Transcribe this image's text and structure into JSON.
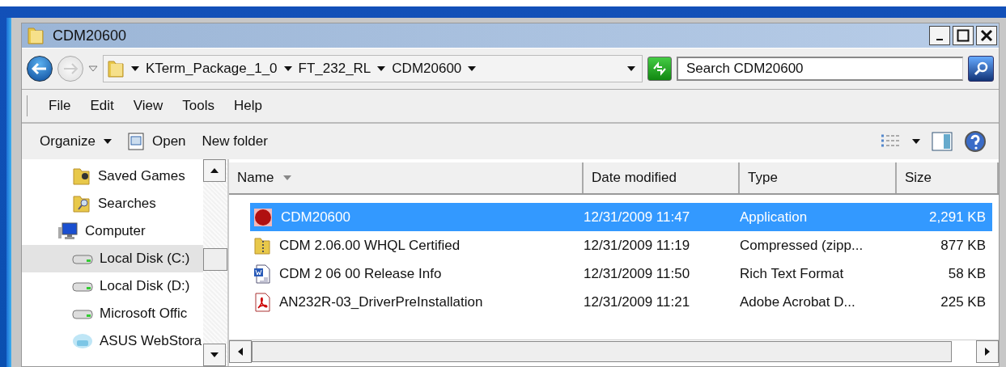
{
  "window": {
    "title": "CDM20600"
  },
  "address_bar": {
    "crumbs": [
      "KTerm_Package_1_0",
      "FT_232_RL",
      "CDM20600"
    ]
  },
  "search": {
    "placeholder": "Search CDM20600"
  },
  "menu": [
    "File",
    "Edit",
    "View",
    "Tools",
    "Help"
  ],
  "toolbar": {
    "organize": "Organize",
    "open": "Open",
    "new_folder": "New folder"
  },
  "sidebar": {
    "items": [
      {
        "label": "Saved Games",
        "kind": "folder",
        "selected": false
      },
      {
        "label": "Searches",
        "kind": "search-folder",
        "selected": false
      },
      {
        "label": "Computer",
        "kind": "computer",
        "selected": false,
        "children": [
          {
            "label": "Local Disk (C:)",
            "kind": "drive",
            "selected": true
          },
          {
            "label": "Local Disk (D:)",
            "kind": "drive",
            "selected": false
          },
          {
            "label": "Microsoft Offic",
            "kind": "drive",
            "selected": false
          },
          {
            "label": "ASUS WebStora",
            "kind": "cloud",
            "selected": false
          }
        ]
      }
    ]
  },
  "table": {
    "columns": [
      "Name",
      "Date modified",
      "Type",
      "Size"
    ],
    "rows": [
      {
        "name": "CDM20600",
        "date": "12/31/2009 11:47",
        "type": "Application",
        "size": "2,291 KB",
        "kind": "app",
        "selected": true
      },
      {
        "name": "CDM 2.06.00 WHQL Certified",
        "date": "12/31/2009 11:19",
        "type": "Compressed (zipp...",
        "size": "877 KB",
        "kind": "zip",
        "selected": false
      },
      {
        "name": "CDM 2 06 00 Release Info",
        "date": "12/31/2009 11:50",
        "type": "Rich Text Format",
        "size": "58 KB",
        "kind": "doc",
        "selected": false
      },
      {
        "name": "AN232R-03_DriverPreInstallation",
        "date": "12/31/2009 11:21",
        "type": "Adobe Acrobat D...",
        "size": "225 KB",
        "kind": "pdf",
        "selected": false
      }
    ]
  }
}
